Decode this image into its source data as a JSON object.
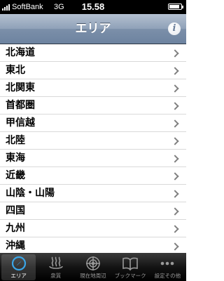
{
  "status_bar": {
    "carrier": "SoftBank",
    "network": "3G",
    "time": "15.58",
    "battery_level": 0.85
  },
  "nav": {
    "title": "エリア",
    "info_icon": "info-icon",
    "info_glyph": "i"
  },
  "areas": [
    {
      "label": "北海道"
    },
    {
      "label": "東北"
    },
    {
      "label": "北関東"
    },
    {
      "label": "首都圏"
    },
    {
      "label": "甲信越"
    },
    {
      "label": "北陸"
    },
    {
      "label": "東海"
    },
    {
      "label": "近畿"
    },
    {
      "label": "山陰・山陽"
    },
    {
      "label": "四国"
    },
    {
      "label": "九州"
    },
    {
      "label": "沖縄"
    }
  ],
  "tabs": [
    {
      "label": "エリア",
      "icon": "compass-icon",
      "active": true
    },
    {
      "label": "泉質",
      "icon": "hot-spring-icon",
      "active": false
    },
    {
      "label": "現在地周辺",
      "icon": "location-radar-icon",
      "active": false
    },
    {
      "label": "ブックマーク",
      "icon": "book-icon",
      "active": false
    },
    {
      "label": "設定その他",
      "icon": "more-dots-icon",
      "active": false
    }
  ],
  "colors": {
    "nav_bar": "#7b8fa9",
    "tab_bar": "#141414",
    "chevron": "#808080"
  }
}
